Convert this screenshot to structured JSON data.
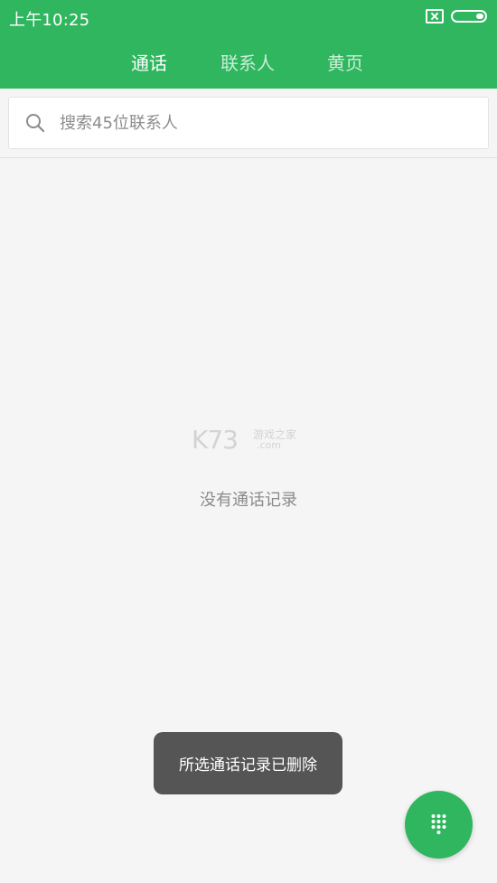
{
  "status_bar": {
    "time": "上午10:25",
    "icons": [
      "sim-icon",
      "battery-icon"
    ]
  },
  "tabs": [
    {
      "label": "通话",
      "active": true
    },
    {
      "label": "联系人",
      "active": false
    },
    {
      "label": "黄页",
      "active": false
    }
  ],
  "search": {
    "placeholder": "搜索45位联系人",
    "value": ""
  },
  "empty_state": {
    "watermark_main": "K73",
    "watermark_sub": "游戏之家",
    "watermark_url": ".com",
    "message": "没有通话记录"
  },
  "toast": {
    "text": "所选通话记录已删除"
  },
  "fab": {
    "icon": "dialpad-icon"
  },
  "colors": {
    "accent": "#2fb65f",
    "background": "#f5f5f5",
    "toast": "#555555"
  }
}
